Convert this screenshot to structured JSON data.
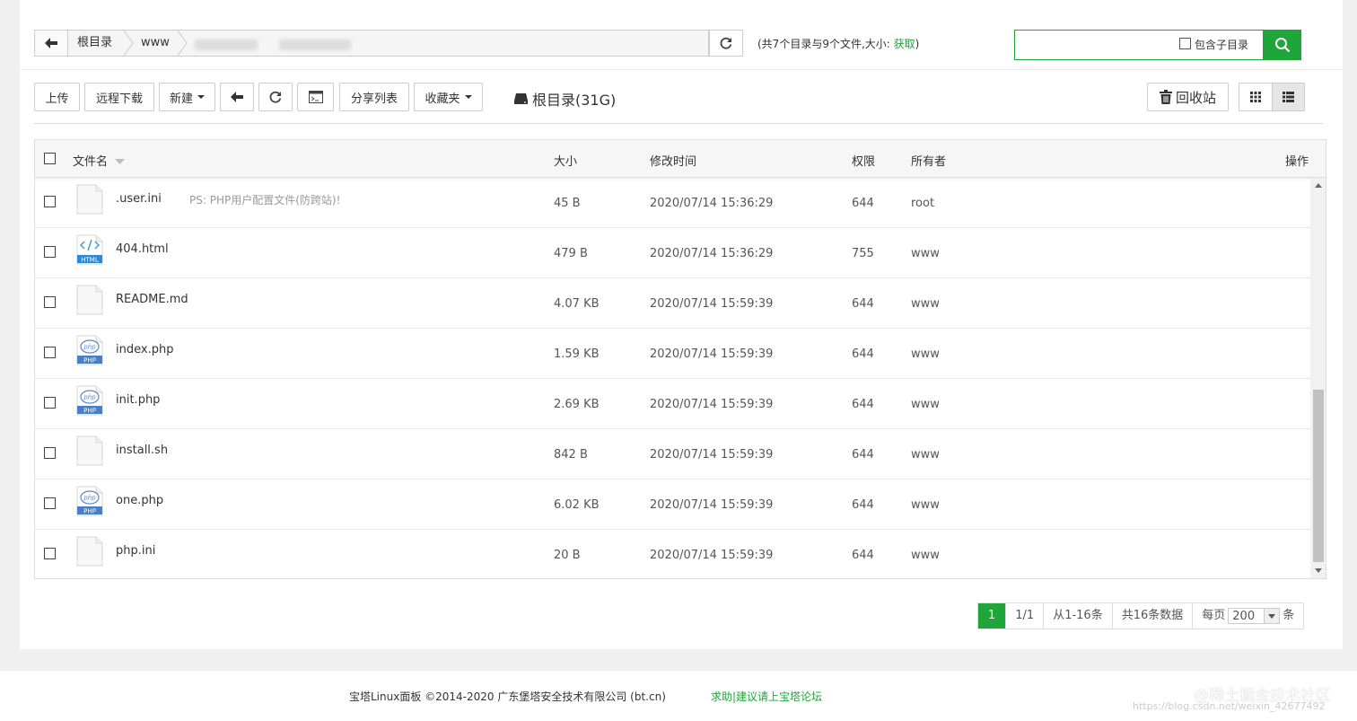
{
  "path": {
    "crumbs": [
      "根目录",
      "www"
    ],
    "summary_prefix": "(共7个目录与9个文件,大小: ",
    "summary_link": "获取",
    "summary_suffix": ")"
  },
  "search": {
    "placeholder": "",
    "include_subdir_label": "包含子目录"
  },
  "toolbar": {
    "upload": "上传",
    "remote_download": "远程下载",
    "new": "新建",
    "share_list": "分享列表",
    "favorites": "收藏夹",
    "disk_label": "根目录(31G)",
    "recycle_bin": "回收站"
  },
  "table": {
    "headers": {
      "name": "文件名",
      "size": "大小",
      "mtime": "修改时间",
      "perm": "权限",
      "owner": "所有者",
      "actions": "操作"
    },
    "rows": [
      {
        "name": ".user.ini",
        "note": "PS: PHP用户配置文件(防跨站)!",
        "size": "45 B",
        "mtime": "2020/07/14 15:36:29",
        "perm": "644",
        "owner": "root",
        "icon": "file-icon"
      },
      {
        "name": "404.html",
        "note": "",
        "size": "479 B",
        "mtime": "2020/07/14 15:36:29",
        "perm": "755",
        "owner": "www",
        "icon": "html-file-icon"
      },
      {
        "name": "README.md",
        "note": "",
        "size": "4.07 KB",
        "mtime": "2020/07/14 15:59:39",
        "perm": "644",
        "owner": "www",
        "icon": "file-icon"
      },
      {
        "name": "index.php",
        "note": "",
        "size": "1.59 KB",
        "mtime": "2020/07/14 15:59:39",
        "perm": "644",
        "owner": "www",
        "icon": "php-file-icon"
      },
      {
        "name": "init.php",
        "note": "",
        "size": "2.69 KB",
        "mtime": "2020/07/14 15:59:39",
        "perm": "644",
        "owner": "www",
        "icon": "php-file-icon"
      },
      {
        "name": "install.sh",
        "note": "",
        "size": "842 B",
        "mtime": "2020/07/14 15:59:39",
        "perm": "644",
        "owner": "www",
        "icon": "file-icon"
      },
      {
        "name": "one.php",
        "note": "",
        "size": "6.02 KB",
        "mtime": "2020/07/14 15:59:39",
        "perm": "644",
        "owner": "www",
        "icon": "php-file-icon"
      },
      {
        "name": "php.ini",
        "note": "",
        "size": "20 B",
        "mtime": "2020/07/14 15:59:39",
        "perm": "644",
        "owner": "www",
        "icon": "file-icon"
      }
    ]
  },
  "pager": {
    "current": "1",
    "pages": "1/1",
    "range": "从1-16条",
    "total": "共16条数据",
    "per_page_label": "每页",
    "per_page_value": "200",
    "per_page_suffix": "条"
  },
  "footer": {
    "copyright": "宝塔Linux面板 ©2014-2020 广东堡塔安全技术有限公司 (bt.cn)",
    "help": "求助|建议请上宝塔论坛"
  },
  "watermark": {
    "brand": "@稀土掘金技术社区",
    "url": "https://blog.csdn.net/weixin_42677492"
  },
  "colors": {
    "accent": "#20a53a",
    "border": "#cccccc"
  }
}
